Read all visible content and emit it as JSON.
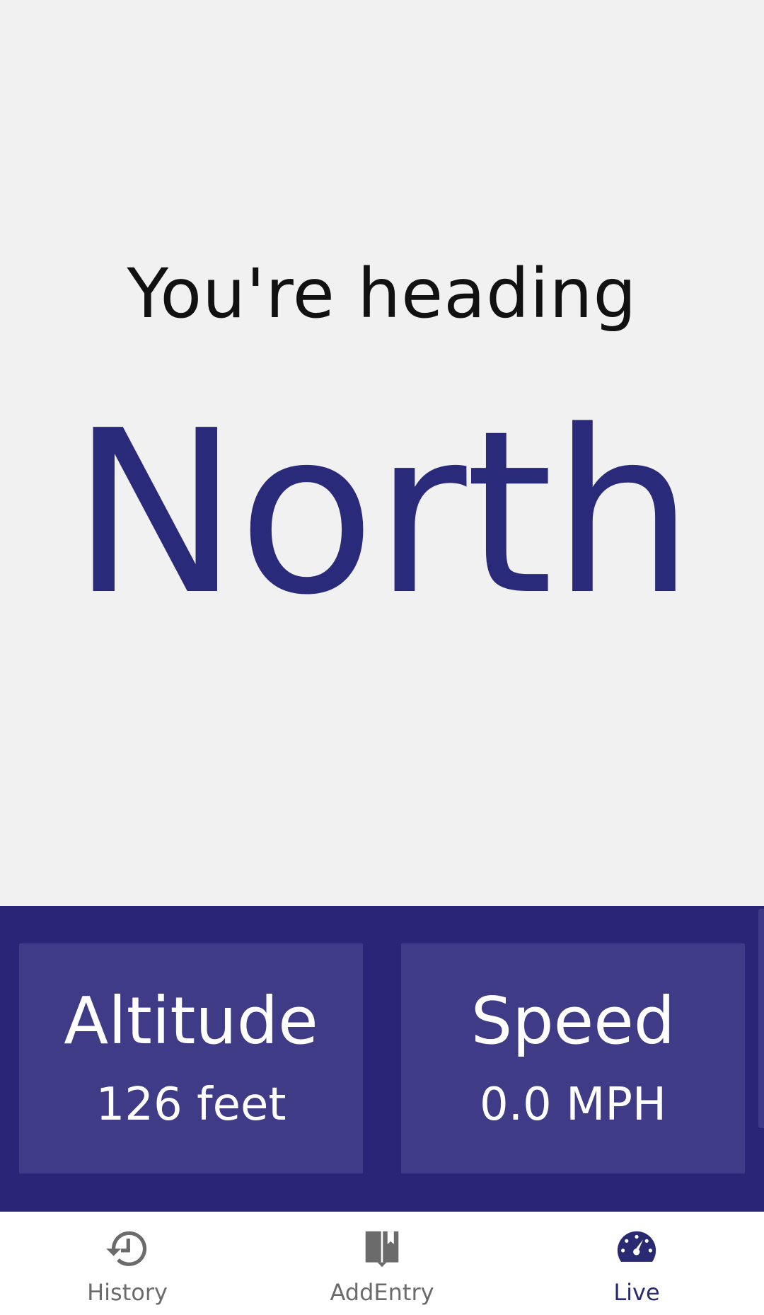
{
  "colors": {
    "background": "#f1f1f1",
    "accent": "#2a2a7a",
    "panel": "#2a2577",
    "card": "#3f3b86",
    "nav_active": "#2a2a72",
    "nav_inactive": "#6b6b6b"
  },
  "heading": {
    "label": "You're heading",
    "direction": "North"
  },
  "stats": {
    "altitude": {
      "title": "Altitude",
      "value": "126 feet"
    },
    "speed": {
      "title": "Speed",
      "value": "0.0 MPH"
    }
  },
  "bottom_nav": {
    "active": "Live",
    "items": [
      {
        "label": "History",
        "icon": "history-icon"
      },
      {
        "label": "AddEntry",
        "icon": "book-icon"
      },
      {
        "label": "Live",
        "icon": "speedometer-icon"
      }
    ]
  }
}
